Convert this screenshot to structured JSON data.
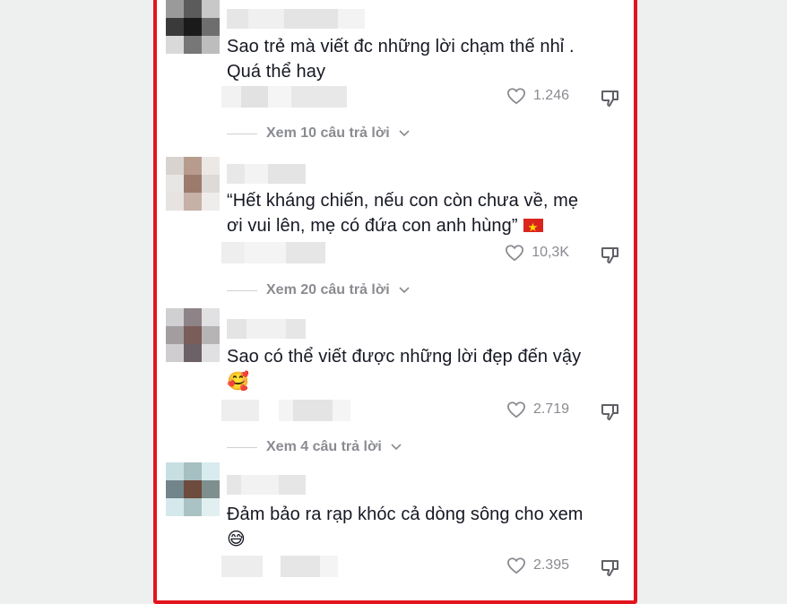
{
  "colors": {
    "frame_border": "#e3141b",
    "text": "#161823",
    "muted": "#8a8b91"
  },
  "comments": [
    {
      "text_line1": "Sao trẻ mà viết đc những lời chạm thế nhỉ .",
      "text_line2": "Quá thể hay",
      "likes": "1.246",
      "replies": "Xem 10 câu trả lời",
      "avatar": [
        "#9a9a9a",
        "#5b5b5b",
        "#c8c8c8",
        "#3a3a3a",
        "#1a1a1a",
        "#6e6e6e",
        "#d9d9d9",
        "#777777",
        "#bdbdbd"
      ]
    },
    {
      "text_line1": "“Hết kháng chiến, nếu con còn chưa về, mẹ",
      "text_line2": "ơi vui lên, mẹ có đứa con anh hùng”",
      "emoji": "flag-vietnam",
      "likes": "10,3K",
      "replies": "Xem 20 câu trả lời",
      "avatar": [
        "#d8d3cf",
        "#b79c8d",
        "#ebe8e6",
        "#e8e6e4",
        "#9d7b6c",
        "#dedad7",
        "#e6e3e1",
        "#c6b1a6",
        "#efedeb"
      ]
    },
    {
      "text_line1": "Sao có thể viết được những lời đẹp đến vậy",
      "text_line2": "🥰",
      "likes": "2.719",
      "replies": "Xem 4 câu trả lời",
      "avatar": [
        "#d0cfd1",
        "#8e8387",
        "#e1e0e2",
        "#a39da0",
        "#7a5d59",
        "#b7b4b6",
        "#cfcdd0",
        "#6b6166",
        "#e0dfe1"
      ]
    },
    {
      "text_line1": "Đảm bảo ra rạp khóc cả dòng sông cho xem",
      "text_line2": "😅",
      "likes": "2.395",
      "avatar": [
        "#c8dfe2",
        "#a6bfc2",
        "#d8ebee",
        "#72858a",
        "#6d4b3d",
        "#7f8f8e",
        "#d5e9ec",
        "#aac2c3",
        "#e1eff1"
      ]
    }
  ]
}
